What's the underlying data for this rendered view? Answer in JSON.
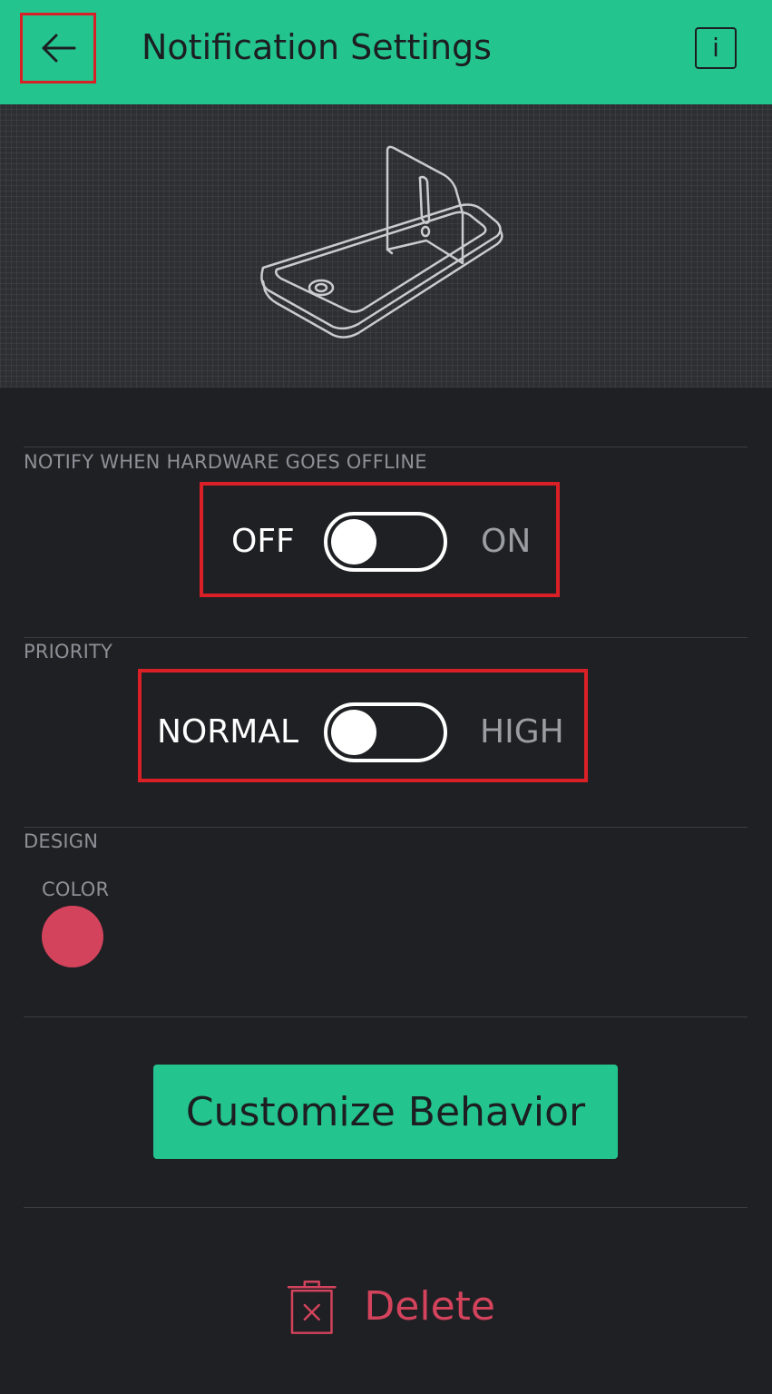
{
  "header": {
    "title": "Notification Settings",
    "back_icon": "arrow-left-icon",
    "info_icon": "info-icon",
    "info_glyph": "i",
    "color": "#23c48e"
  },
  "hero": {
    "illustration": "phone-alert-illustration"
  },
  "offline": {
    "section_label": "NOTIFY WHEN HARDWARE GOES OFFLINE",
    "off_label": "OFF",
    "on_label": "ON",
    "state": "OFF"
  },
  "priority": {
    "section_label": "PRIORITY",
    "normal_label": "NORMAL",
    "high_label": "HIGH",
    "state": "NORMAL"
  },
  "design": {
    "section_label": "DESIGN",
    "color_label": "COLOR",
    "color_value": "#d3435c"
  },
  "actions": {
    "customize_label": "Customize Behavior",
    "delete_label": "Delete",
    "delete_icon": "trash-icon",
    "delete_color": "#d3435c"
  }
}
